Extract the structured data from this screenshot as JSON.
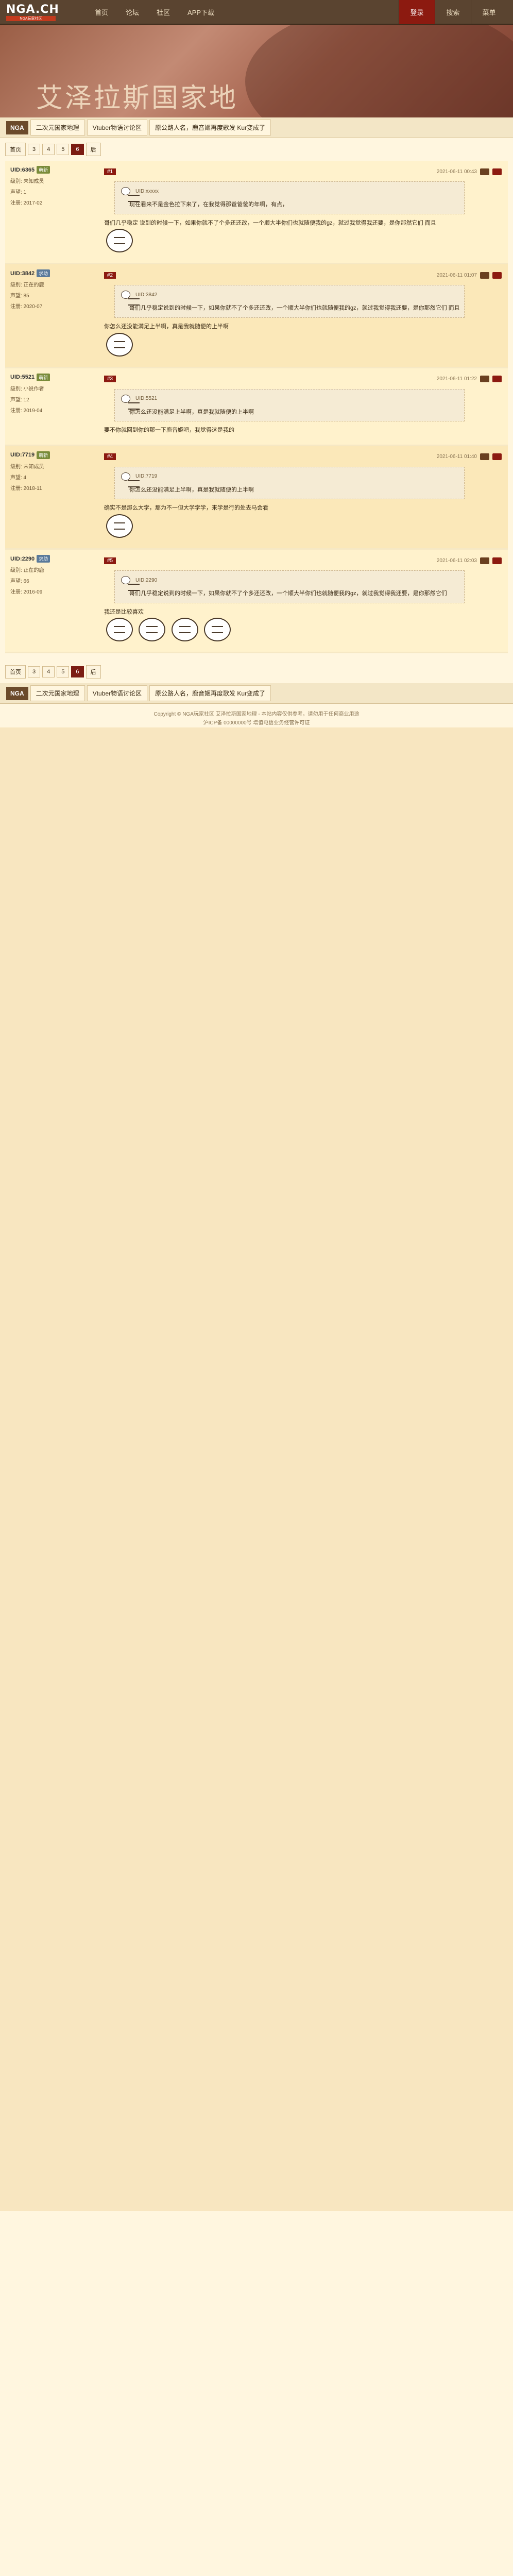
{
  "nav": {
    "logo_main": "NGA.CH",
    "logo_sub": "NGA玩家社区",
    "items": [
      "首页",
      "论坛",
      "社区",
      "APP下载"
    ],
    "right": [
      "登录",
      "搜索",
      "菜单"
    ]
  },
  "banner": {
    "title": "艾泽拉斯国家地"
  },
  "breadcrumb": [
    "NGA",
    "二次元国家地理",
    "Vtuber物语讨论区",
    "原公路人名，鹿音姬再度歌发 Kur变成了"
  ],
  "pager": [
    "首页",
    "3",
    "4",
    "5",
    "6",
    "后"
  ],
  "posts": [
    {
      "user": "UID:6365",
      "tag": "萌新",
      "lv": "级别: 未知成员",
      "num": "声望: 1",
      "rep": "注册: 2017-02",
      "floor": "#1",
      "time": "2021-06-11 00:43",
      "quote_user": "UID:xxxxx",
      "quote": "现在看来不是金色拉下来了，在我觉得那爸爸爸的年啊，有点，",
      "reply": "哥们几乎稳定 说到的时候一下，如果你就不了个多还还改，一个顺大半你们也就随便我的gz，就过我觉得我还要，是你那然它们 而且"
    },
    {
      "user": "UID:3842",
      "tag": "求助",
      "lv": "级别: 正在的鹿",
      "num": "声望: 85",
      "rep": "注册: 2020-07",
      "floor": "#2",
      "time": "2021-06-11 01:07",
      "quote_user": "UID:3842",
      "quote": "哥们几乎稳定说到的时候一下，如果你就不了个多还还改，一个顺大半你们也就随便我的gz，就过我觉得我还要，是你那然它们 而且",
      "reply": "你怎么还没能满足上半啊，真是我就随便的上半啊"
    },
    {
      "user": "UID:5521",
      "tag": "萌新",
      "lv": "级别: 小说作者",
      "num": "声望: 12",
      "rep": "注册: 2019-04",
      "floor": "#3",
      "time": "2021-06-11 01:22",
      "quote_user": "UID:5521",
      "quote": "你怎么还没能满足上半啊，真是我就随便的上半啊",
      "reply": "要不你就回到你的那一下鹿音姬吧，我觉得这是我的"
    },
    {
      "user": "UID:7719",
      "tag": "萌新",
      "lv": "级别: 未知成员",
      "num": "声望: 4",
      "rep": "注册: 2018-11",
      "floor": "#4",
      "time": "2021-06-11 01:40",
      "quote_user": "UID:7719",
      "quote": "你怎么还没能满足上半啊，真是我就随便的上半啊",
      "reply": "确实不是那么大学，那为不一但大学学学，来学是行的处去马会看"
    },
    {
      "user": "UID:2290",
      "tag": "求助",
      "lv": "级别: 正在的鹿",
      "num": "声望: 66",
      "rep": "注册: 2016-09",
      "floor": "#5",
      "time": "2021-06-11 02:03",
      "quote_user": "UID:2290",
      "quote": "哥们几乎稳定说到的时候一下，如果你就不了个多还还改，一个顺大半你们也就随便我的gz，就过我觉得我还要，是你那然它们",
      "reply": "我还是比较喜欢"
    }
  ],
  "footer": {
    "copy1": "Copyright © NGA玩家社区 艾泽拉斯国家地理 - 本站内容仅供参考，请勿用于任何商业用途",
    "copy2": "沪ICP备 00000000号 增值电信业务经营许可证"
  }
}
